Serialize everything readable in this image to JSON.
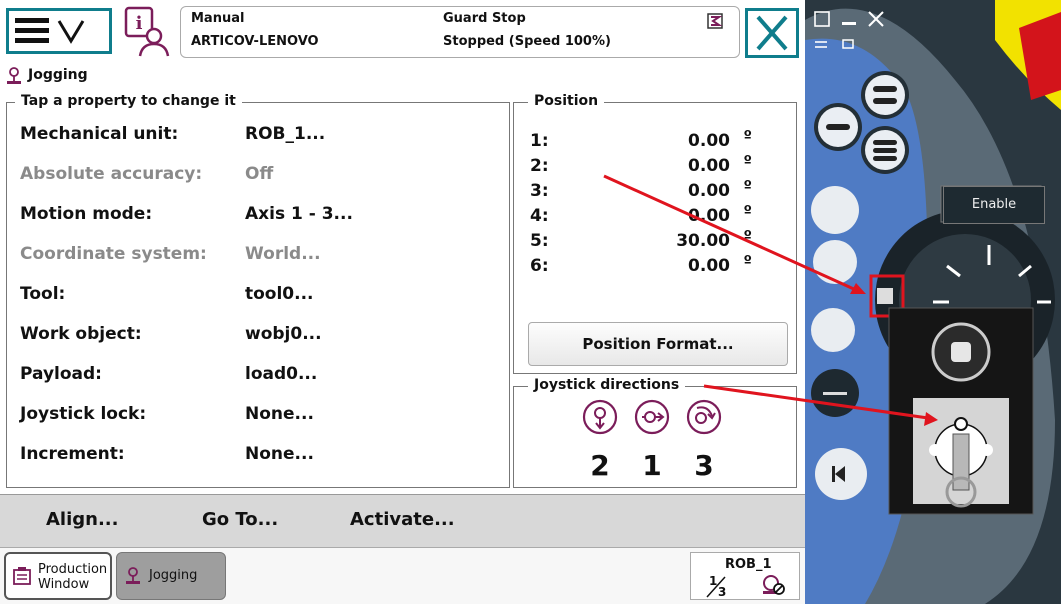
{
  "header": {
    "mode": "Manual",
    "controller": "ARTICOV-LENOVO",
    "state": "Guard Stop",
    "run_state": "Stopped (Speed 100%)"
  },
  "app_title": "Jogging",
  "properties": {
    "title": "Tap a property to change it",
    "items": [
      {
        "label": "Mechanical unit:",
        "value": "ROB_1..."
      },
      {
        "label": "Absolute accuracy:",
        "value": "Off"
      },
      {
        "label": "Motion mode:",
        "value": "Axis 1 - 3..."
      },
      {
        "label": "Coordinate system:",
        "value": "World..."
      },
      {
        "label": "Tool:",
        "value": "tool0..."
      },
      {
        "label": "Work object:",
        "value": "wobj0..."
      },
      {
        "label": "Payload:",
        "value": "load0..."
      },
      {
        "label": "Joystick lock:",
        "value": "None..."
      },
      {
        "label": "Increment:",
        "value": "None..."
      }
    ]
  },
  "position": {
    "title": "Position",
    "unit": "º",
    "rows": [
      {
        "n": "1:",
        "v": "0.00"
      },
      {
        "n": "2:",
        "v": "0.00"
      },
      {
        "n": "3:",
        "v": "0.00"
      },
      {
        "n": "4:",
        "v": "0.00"
      },
      {
        "n": "5:",
        "v": "30.00"
      },
      {
        "n": "6:",
        "v": "0.00"
      }
    ],
    "format_button": "Position Format..."
  },
  "joystick": {
    "title": "Joystick directions",
    "axes": [
      "2",
      "1",
      "3"
    ]
  },
  "commands": {
    "align": "Align...",
    "goto": "Go To...",
    "activate": "Activate..."
  },
  "taskbar": {
    "production_line1": "Production",
    "production_line2": "Window",
    "jogging": "Jogging",
    "rob_unit": "ROB_1",
    "fraction": "1/3"
  },
  "flexpendant": {
    "enable_label": "Enable"
  },
  "colors": {
    "accent": "#0f7d8c",
    "icon": "#7b1d5a",
    "arrow": "#e0141e"
  }
}
